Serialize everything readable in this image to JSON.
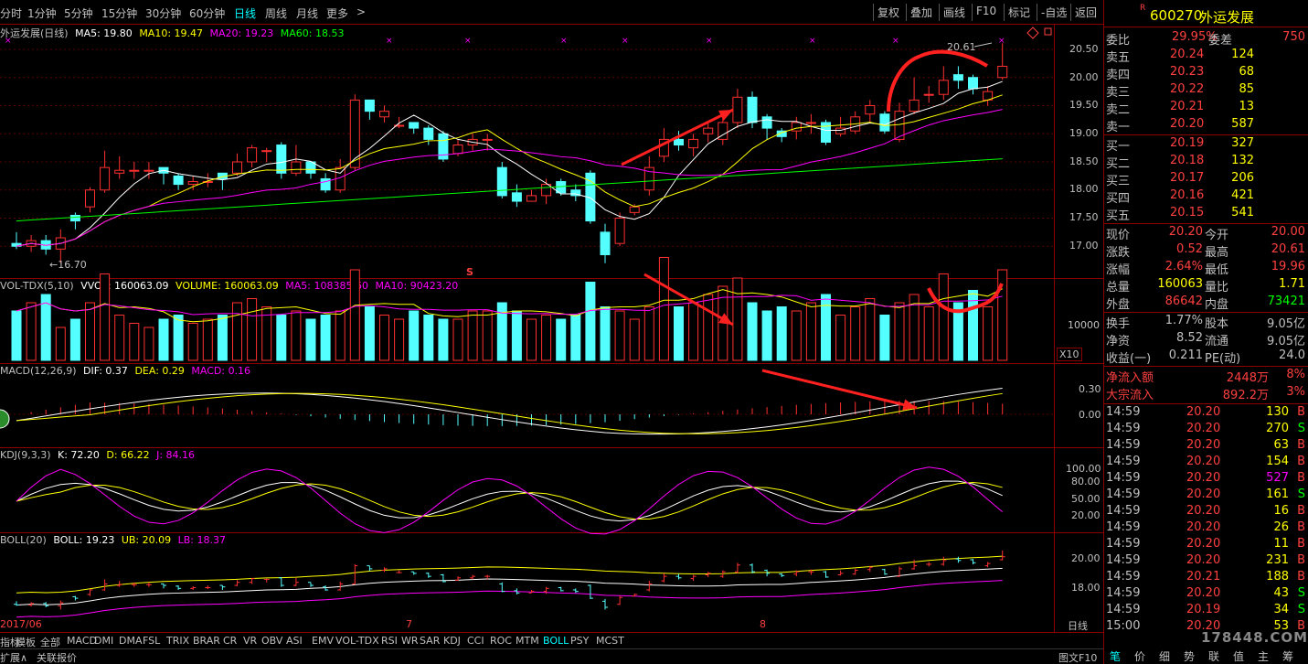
{
  "toolbar": {
    "timeframes": [
      "分时",
      "1分钟",
      "5分钟",
      "15分钟",
      "30分钟",
      "60分钟",
      "日线",
      "周线",
      "月线",
      "更多"
    ],
    "active": "日线",
    "more_arrow": ">",
    "buttons": [
      "复权",
      "叠加",
      "画线",
      "F10",
      "标记",
      "-自选",
      "返回"
    ]
  },
  "main": {
    "title": "外运发展(日线)",
    "ma": [
      {
        "label": "MA5: 19.80",
        "color": "#ffffff"
      },
      {
        "label": "MA10: 19.47",
        "color": "#ffff00"
      },
      {
        "label": "MA20: 19.23",
        "color": "#ff00ff"
      },
      {
        "label": "MA60: 18.53",
        "color": "#00ff00"
      }
    ],
    "ylabels": [
      "20.50",
      "20.00",
      "19.50",
      "19.00",
      "18.50",
      "18.00",
      "17.50",
      "17.00"
    ],
    "high_marker": "20.61",
    "low_marker": "←16.70",
    "s_marker": "S"
  },
  "vol": {
    "title": "VOL-TDX(5,10)",
    "items": [
      {
        "label": "VVOL: 160063.09",
        "color": "#ffffff"
      },
      {
        "label": "VOLUME: 160063.09",
        "color": "#ffff00"
      },
      {
        "label": "MA5: 108385.60",
        "color": "#ff00ff"
      },
      {
        "label": "MA10: 90423.20",
        "color": "#ff00ff"
      }
    ],
    "ylabel": "10000",
    "unit": "X10"
  },
  "macd": {
    "title": "MACD(12,26,9)",
    "items": [
      {
        "label": "DIF: 0.37",
        "color": "#ffffff"
      },
      {
        "label": "DEA: 0.29",
        "color": "#ffff00"
      },
      {
        "label": "MACD: 0.16",
        "color": "#ff00ff"
      }
    ],
    "ylabels": [
      "0.30",
      "0.00"
    ]
  },
  "kdj": {
    "title": "KDJ(9,3,3)",
    "items": [
      {
        "label": "K: 72.20",
        "color": "#ffffff"
      },
      {
        "label": "D: 66.22",
        "color": "#ffff00"
      },
      {
        "label": "J: 84.16",
        "color": "#ff00ff"
      }
    ],
    "ylabels": [
      "100.00",
      "80.00",
      "50.00",
      "20.00"
    ]
  },
  "boll": {
    "title": "BOLL(20)",
    "items": [
      {
        "label": "BOLL: 19.23",
        "color": "#ffffff"
      },
      {
        "label": "UB: 20.09",
        "color": "#ffff00"
      },
      {
        "label": "LB: 18.37",
        "color": "#ff00ff"
      }
    ],
    "ylabels": [
      "20.00",
      "18.00"
    ]
  },
  "xaxis": {
    "labels": [
      "2017/06",
      "7",
      "8"
    ],
    "period": "日线"
  },
  "tabs": [
    "指标",
    "模板",
    "全部",
    "MACD",
    "DMI",
    "DMA",
    "FSL",
    "TRIX",
    "BRAR",
    "CR",
    "VR",
    "OBV",
    "ASI",
    "EMV",
    "VOL-TDX",
    "RSI",
    "WR",
    "SAR",
    "KDJ",
    "CCI",
    "ROC",
    "MTM",
    "BOLL",
    "PSY",
    "MCST"
  ],
  "active_tab": "BOLL",
  "bottom_links": [
    "扩展∧",
    "关联报价"
  ],
  "bottom_right": "图文F10",
  "quote": {
    "flag": "R",
    "code": "600270",
    "name": "外运发展",
    "weibi_label": "委比",
    "weibi": "29.95%",
    "weicha_label": "委差",
    "weicha": "750",
    "sell": [
      {
        "l": "卖五",
        "p": "20.24",
        "v": "124"
      },
      {
        "l": "卖四",
        "p": "20.23",
        "v": "68"
      },
      {
        "l": "卖三",
        "p": "20.22",
        "v": "85"
      },
      {
        "l": "卖二",
        "p": "20.21",
        "v": "13"
      },
      {
        "l": "卖一",
        "p": "20.20",
        "v": "587"
      }
    ],
    "buy": [
      {
        "l": "买一",
        "p": "20.19",
        "v": "327"
      },
      {
        "l": "买二",
        "p": "20.18",
        "v": "132"
      },
      {
        "l": "买三",
        "p": "20.17",
        "v": "206"
      },
      {
        "l": "买四",
        "p": "20.16",
        "v": "421"
      },
      {
        "l": "买五",
        "p": "20.15",
        "v": "541"
      }
    ],
    "stats": [
      {
        "l1": "现价",
        "v1": "20.20",
        "c1": "#ff4040",
        "l2": "今开",
        "v2": "20.00",
        "c2": "#ff4040"
      },
      {
        "l1": "涨跌",
        "v1": "0.52",
        "c1": "#ff4040",
        "l2": "最高",
        "v2": "20.61",
        "c2": "#ff4040"
      },
      {
        "l1": "涨幅",
        "v1": "2.64%",
        "c1": "#ff4040",
        "l2": "最低",
        "v2": "19.96",
        "c2": "#ff4040"
      },
      {
        "l1": "总量",
        "v1": "160063",
        "c1": "#ffff00",
        "l2": "量比",
        "v2": "1.71",
        "c2": "#ffff00"
      },
      {
        "l1": "外盘",
        "v1": "86642",
        "c1": "#ff4040",
        "l2": "内盘",
        "v2": "73421",
        "c2": "#00ff00"
      }
    ],
    "stats2": [
      {
        "l1": "换手",
        "v1": "1.77%",
        "l2": "股本",
        "v2": "9.05亿"
      },
      {
        "l1": "净资",
        "v1": "8.52",
        "l2": "流通",
        "v2": "9.05亿"
      },
      {
        "l1": "收益(一)",
        "v1": "0.211",
        "l2": "PE(动)",
        "v2": "24.0"
      }
    ],
    "flow": [
      {
        "l": "净流入额",
        "v": "2448万",
        "p": "8%"
      },
      {
        "l": "大宗流入",
        "v": "892.2万",
        "p": "3%"
      }
    ]
  },
  "ticks": [
    {
      "t": "14:59",
      "p": "20.20",
      "v": "130",
      "d": "B"
    },
    {
      "t": "14:59",
      "p": "20.20",
      "v": "270",
      "d": "S"
    },
    {
      "t": "14:59",
      "p": "20.20",
      "v": "63",
      "d": "B"
    },
    {
      "t": "14:59",
      "p": "20.20",
      "v": "154",
      "d": "B"
    },
    {
      "t": "14:59",
      "p": "20.20",
      "v": "527",
      "d": "B"
    },
    {
      "t": "14:59",
      "p": "20.20",
      "v": "161",
      "d": "S"
    },
    {
      "t": "14:59",
      "p": "20.20",
      "v": "16",
      "d": "B"
    },
    {
      "t": "14:59",
      "p": "20.20",
      "v": "26",
      "d": "B"
    },
    {
      "t": "14:59",
      "p": "20.20",
      "v": "11",
      "d": "B"
    },
    {
      "t": "14:59",
      "p": "20.20",
      "v": "231",
      "d": "B"
    },
    {
      "t": "14:59",
      "p": "20.21",
      "v": "188",
      "d": "B"
    },
    {
      "t": "14:59",
      "p": "20.20",
      "v": "43",
      "d": "S"
    },
    {
      "t": "14:59",
      "p": "20.19",
      "v": "34",
      "d": "S"
    },
    {
      "t": "15:00",
      "p": "20.20",
      "v": "53",
      "d": "B"
    }
  ],
  "right_tabs": [
    "笔",
    "价",
    "细",
    "势",
    "联",
    "值",
    "主",
    "筹"
  ],
  "watermark": "178448.COM"
}
